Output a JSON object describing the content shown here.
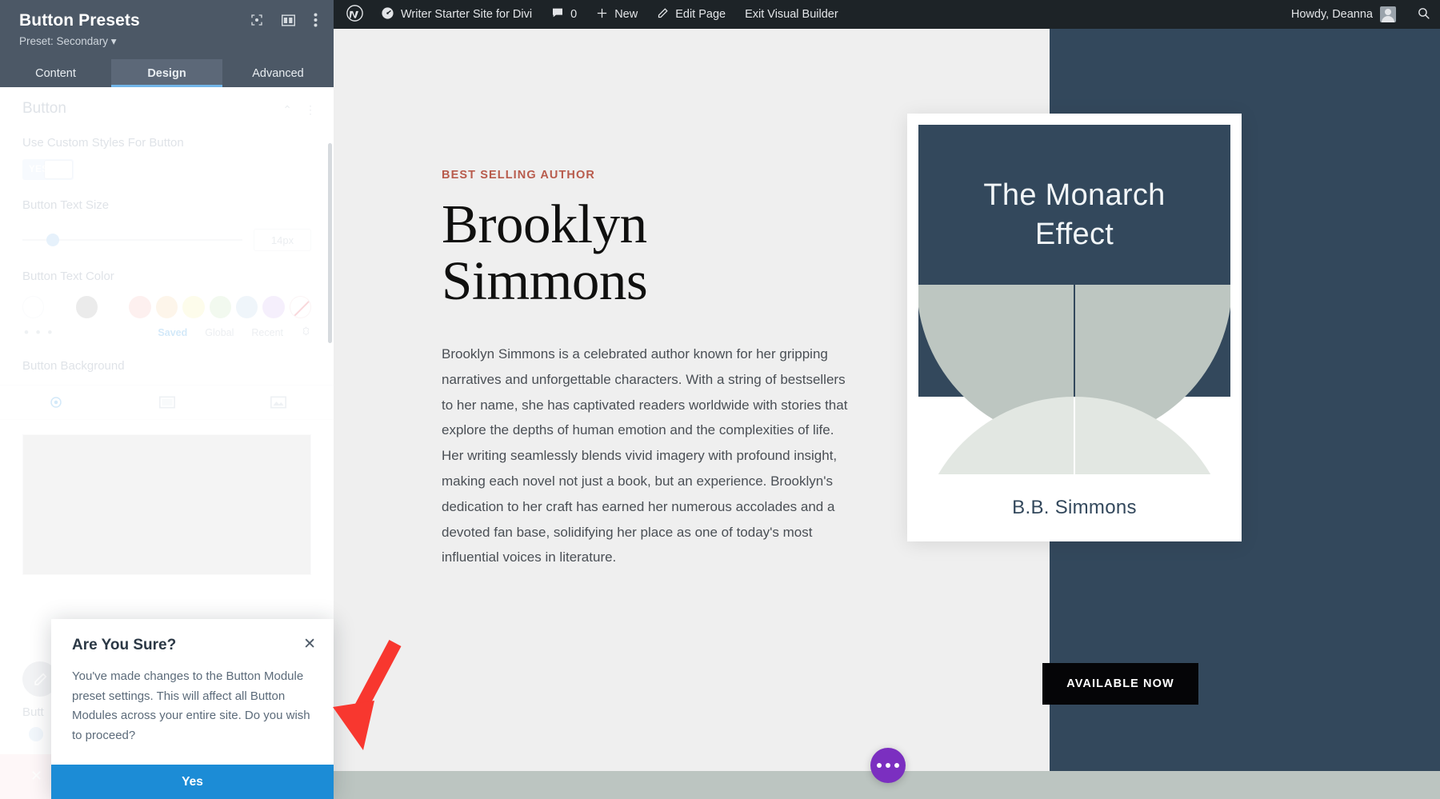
{
  "settings_panel": {
    "title": "Button Presets",
    "preset_line": "Preset: Secondary ▾",
    "header_icons": [
      {
        "name": "focus-target-icon",
        "glyph": "⊡"
      },
      {
        "name": "layout-columns-icon",
        "glyph": "▥"
      },
      {
        "name": "more-vertical-icon",
        "glyph": "⋮"
      }
    ],
    "tabs": [
      {
        "label": "Content",
        "active": false
      },
      {
        "label": "Design",
        "active": true
      },
      {
        "label": "Advanced",
        "active": false
      }
    ],
    "section": {
      "title": "Button",
      "collapse_icon": "⌃",
      "menu_icon": "⋮"
    },
    "fields": {
      "custom_styles_label": "Use Custom Styles For Button",
      "toggle_value": "YES",
      "text_size_label": "Button Text Size",
      "text_size_value": "14px",
      "text_color_label": "Button Text Color",
      "background_label": "Button Background",
      "bottom_label": "Butt"
    },
    "color_tabs": [
      "Saved",
      "Global",
      "Recent"
    ],
    "color_tab_selected": "Saved",
    "swatch_dots": "• • •",
    "swatches": [
      {
        "name": "swatch-none",
        "hex": "#ffffff"
      },
      {
        "name": "swatch-gray",
        "hex": "#b7b7b7"
      },
      {
        "name": "swatch-red",
        "hex": "#f8c9c5"
      },
      {
        "name": "swatch-orange",
        "hex": "#f7dcb5"
      },
      {
        "name": "swatch-yellow",
        "hex": "#f6f4b8"
      },
      {
        "name": "swatch-green",
        "hex": "#cfe9c6"
      },
      {
        "name": "swatch-blue",
        "hex": "#c5daee"
      },
      {
        "name": "swatch-purple",
        "hex": "#dcc5f2"
      },
      {
        "name": "swatch-clear",
        "hex": "#ffffff"
      }
    ],
    "bg_tabs": [
      {
        "name": "background-color-tab",
        "glyph": "◉"
      },
      {
        "name": "background-gradient-tab",
        "glyph": "▤"
      },
      {
        "name": "background-image-tab",
        "glyph": "▣"
      }
    ],
    "preview_color": "#d7d7d7",
    "edit_icon": "✎",
    "close_icon": "✕"
  },
  "confirm_dialog": {
    "title": "Are You Sure?",
    "close_label": "✕",
    "body": "You've made changes to the Button Module preset settings. This will affect all Button Modules across your entire site. Do you wish to proceed?",
    "confirm_label": "Yes"
  },
  "admin_bar": {
    "wp_logo": "wordpress-logo-icon",
    "site_icon": "dashboard-icon",
    "site_name": "Writer Starter Site for Divi",
    "comments_icon": "comment-bubble-icon",
    "comments_count": "0",
    "new_icon": "plus-icon",
    "new_label": "New",
    "edit_icon": "pencil-icon",
    "edit_label": "Edit Page",
    "exit_label": "Exit Visual Builder",
    "howdy": "Howdy, Deanna",
    "search_icon": "search-icon"
  },
  "page": {
    "eyebrow": "BEST SELLING AUTHOR",
    "heading_line1": "Brooklyn",
    "heading_line2": "Simmons",
    "paragraph": "Brooklyn Simmons is a celebrated author known for her gripping narratives and unforgettable characters. With a string of bestsellers to her name, she has captivated readers worldwide with stories that explore the depths of human emotion and the complexities of life. Her writing seamlessly blends vivid imagery with profound insight, making each novel not just a book, but an experience. Brooklyn's dedication to her craft has earned her numerous accolades and a devoted fan base, solidifying her place as one of today's most influential voices in literature.",
    "book": {
      "title_line1": "The Monarch",
      "title_line2": "Effect",
      "author": "B.B. Simmons",
      "cover_bg": "#33485c",
      "petal_top": "#bdc6c1",
      "petal_bottom": "#e2e7e2"
    },
    "available_button": "AVAILABLE NOW",
    "fab_icon": "ellipsis-icon",
    "colors": {
      "left_bg": "#efefef",
      "right_bg": "#33485c",
      "footer_bg": "#bcc5c1",
      "accent_red": "#b85b4c",
      "fab_purple": "#7b2fc0"
    }
  },
  "annotation": {
    "arrow_color": "#f8372f"
  }
}
